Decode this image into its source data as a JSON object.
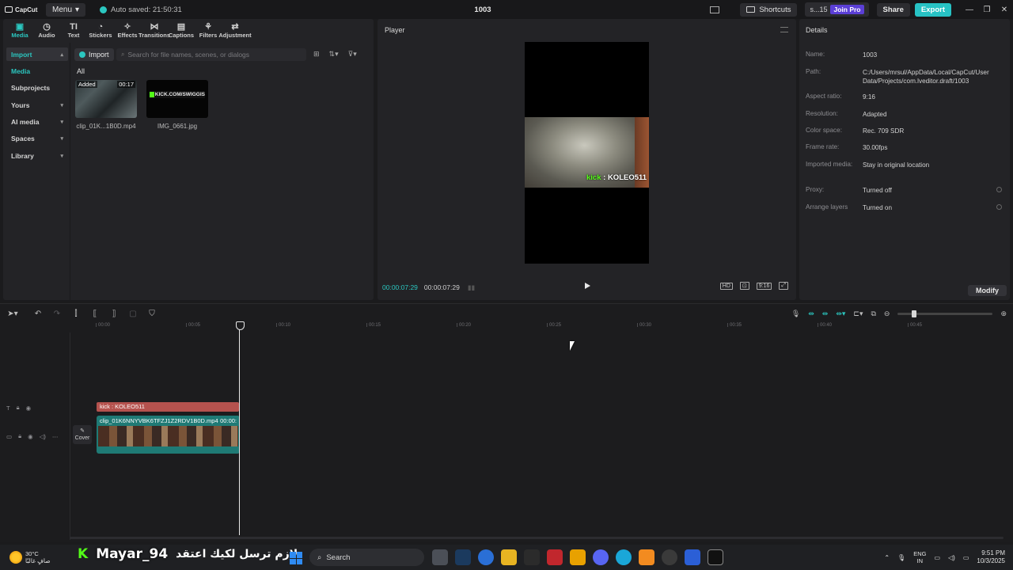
{
  "app": {
    "logo_text": "CapCut",
    "menu_label": "Menu",
    "autosave_text": "Auto saved: 21:50:31",
    "project_title": "1003",
    "shortcuts_label": "Shortcuts",
    "user_label": "s...15",
    "join_pro_label": "Join Pro",
    "share_label": "Share",
    "export_label": "Export",
    "accent_color": "#2bc7c0"
  },
  "toolbar_tabs": [
    {
      "label": "Media",
      "icon": "media-icon"
    },
    {
      "label": "Audio",
      "icon": "audio-icon"
    },
    {
      "label": "Text",
      "icon": "text-icon"
    },
    {
      "label": "Stickers",
      "icon": "sticker-icon"
    },
    {
      "label": "Effects",
      "icon": "effects-icon"
    },
    {
      "label": "Transitions",
      "icon": "transitions-icon"
    },
    {
      "label": "Captions",
      "icon": "captions-icon"
    },
    {
      "label": "Filters",
      "icon": "filters-icon"
    },
    {
      "label": "Adjustment",
      "icon": "adjustment-icon"
    }
  ],
  "sidebar": {
    "items": [
      {
        "label": "Import"
      },
      {
        "label": "Media"
      },
      {
        "label": "Subprojects"
      },
      {
        "label": "Yours"
      },
      {
        "label": "AI media"
      },
      {
        "label": "Spaces"
      },
      {
        "label": "Library"
      }
    ]
  },
  "media_panel": {
    "import_label": "Import",
    "search_placeholder": "Search for file names, scenes, or dialogs",
    "filter_label": "All",
    "items": [
      {
        "name": "clip_01K...1B0D.mp4",
        "badge": "Added",
        "duration": "00:17"
      },
      {
        "name": "IMG_0661.jpg",
        "overlay_text": "KICK.COM/SWIGGIS"
      }
    ]
  },
  "player": {
    "title": "Player",
    "overlay_prefix": "kick",
    "overlay_text": " : KOLEO511",
    "current_time": "00:00:07:29",
    "total_time": "00:00:07:29",
    "ratio_label": "9:16"
  },
  "details": {
    "title": "Details",
    "rows": [
      {
        "key": "Name:",
        "value": "1003"
      },
      {
        "key": "Path:",
        "value": "C:/Users/mrsul/AppData/Local/CapCut/User Data/Projects/com.lveditor.draft/1003"
      },
      {
        "key": "Aspect ratio:",
        "value": "9:16"
      },
      {
        "key": "Resolution:",
        "value": "Adapted"
      },
      {
        "key": "Color space:",
        "value": "Rec. 709 SDR"
      },
      {
        "key": "Frame rate:",
        "value": "30.00fps"
      },
      {
        "key": "Imported media:",
        "value": "Stay in original location"
      },
      {
        "key": "Proxy:",
        "value": "Turned off"
      },
      {
        "key": "Arrange layers",
        "value": "Turned on"
      }
    ],
    "modify_label": "Modify"
  },
  "timeline": {
    "ruler_ticks": [
      "00:00",
      "00:05",
      "00:10",
      "00:15",
      "00:20",
      "00:25",
      "00:30",
      "00:35",
      "00:40",
      "00:45"
    ],
    "text_clip_label": "kick : KOLEO511",
    "video_clip_label": "clip_01K6NNYVBK6TFZJ1Z2RDV1B0D.mp4",
    "video_clip_duration": "00:00:",
    "cover_label": "Cover"
  },
  "taskbar": {
    "temperature": "30°C",
    "weather_desc": "صافٍ غالبًا",
    "streamer_name": "Mayar_94",
    "stream_message": "لازم ترسل لكيك اعتقد",
    "search_label": "Search",
    "lang_top": "ENG",
    "lang_bottom": "IN",
    "time": "9:51 PM",
    "date": "10/3/2025"
  }
}
